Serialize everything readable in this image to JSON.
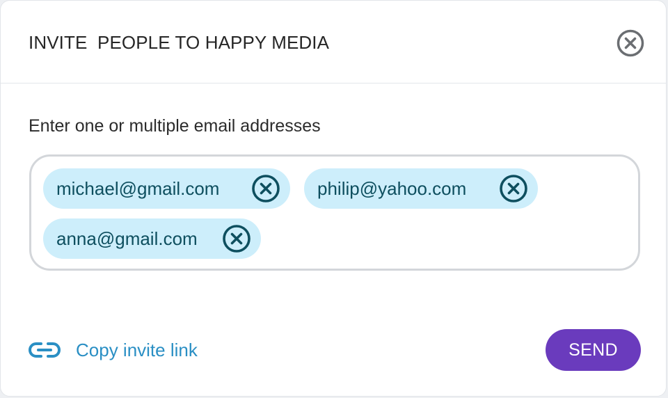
{
  "dialog": {
    "title": "INVITE  PEOPLE TO HAPPY MEDIA",
    "close_icon": "close-circle-icon"
  },
  "form": {
    "prompt": "Enter one or multiple email addresses",
    "emails": [
      {
        "address": "michael@gmail.com",
        "remove_icon": "remove-circle-icon"
      },
      {
        "address": "philip@yahoo.com",
        "remove_icon": "remove-circle-icon"
      },
      {
        "address": "anna@gmail.com",
        "remove_icon": "remove-circle-icon"
      }
    ]
  },
  "footer": {
    "copy_link_icon": "link-icon",
    "copy_link_label": "Copy invite link",
    "send_label": "SEND"
  },
  "colors": {
    "accent": "#6a3bbd",
    "link": "#2a8fc4",
    "chip_bg": "#cdeefb",
    "chip_text": "#0e4f5f"
  }
}
